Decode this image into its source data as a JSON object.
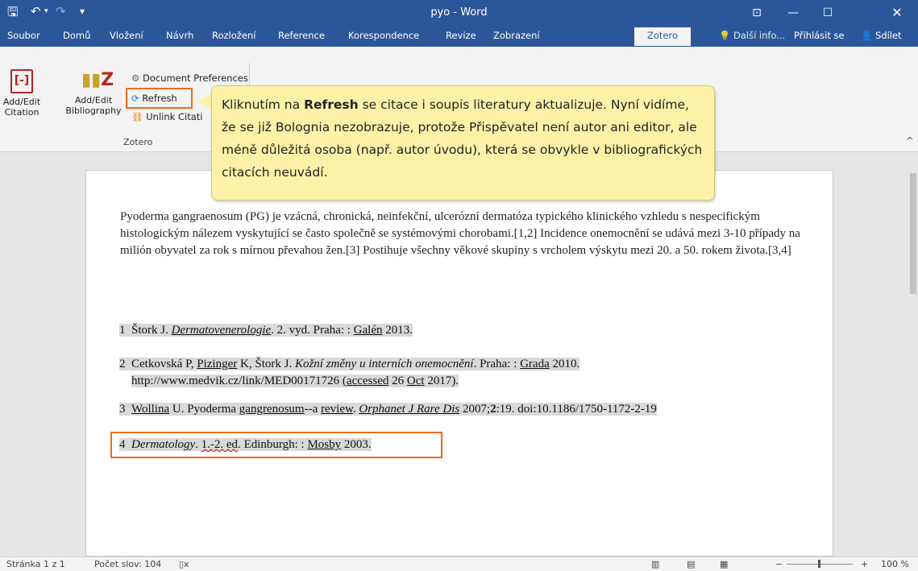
{
  "window": {
    "title": "pyo - Word",
    "undo_icon": "undo-icon",
    "redo_icon": "redo-icon"
  },
  "tabs": [
    "Soubor",
    "Domů",
    "Vložení",
    "Návrh",
    "Rozložení",
    "Reference",
    "Korespondence",
    "Revize",
    "Zobrazení",
    "Zotero"
  ],
  "active_tab": "Zotero",
  "tellme": "Další info...",
  "signin": "Přihlásit se",
  "share": "Sdílet",
  "ribbon": {
    "add_edit_citation_1": "Add/Edit",
    "add_edit_citation_2": "Citation",
    "add_edit_bibliography_1": "Add/Edit",
    "add_edit_bibliography_2": "Bibliography",
    "document_preferences": "Document Preferences",
    "refresh": "Refresh",
    "unlink_citations": "Unlink Citati",
    "group_label": "Zotero"
  },
  "callout": {
    "pre": "Kliknutím na ",
    "bold": "Refresh",
    "post": " se citace i soupis literatury aktualizuje. Nyní vidíme, že se již Bolognia nezobrazuje, protože Přispěvatel není autor ani editor, ale méně důležitá osoba (např. autor úvodu), která se obvykle v bibliografických citacích neuvádí."
  },
  "document": {
    "paragraph": "Pyoderma gangraenosum (PG) je vzácná, chronická, neinfekční, ulcerózní dermatóza typického klinického vzhledu s nespecifickým histologickým nálezem vyskytující se často společně se systémovými chorobami.[1,2] Incidence onemocnění se udává mezi 3-10 případy na milión obyvatel za rok s mírnou převahou žen.[3] Postihuje všechny věkové skupiny s vrcholem výskytu mezi 20. a 50. rokem života.[3,4]",
    "refs": {
      "r1_num": "1",
      "r1_a": "Štork J. ",
      "r1_i": "Dermatovenerologie",
      "r1_b": ". 2. vyd. Praha: : ",
      "r1_c": "Galén",
      "r1_d": " 2013.",
      "r2_num": "2",
      "r2_a": "Cetkovská P, ",
      "r2_b": "Pizinger",
      "r2_c": " K, Štork J. ",
      "r2_i": "Kožní změny u interních onemocnění",
      "r2_d": ". Praha: : ",
      "r2_e": "Grada",
      "r2_f": " 2010.",
      "r2_line2a": "http://www.medvik.cz/link/MED00171726 (",
      "r2_line2b": "accessed",
      "r2_line2c": " 26 ",
      "r2_line2d": "Oct",
      "r2_line2e": " 2017).",
      "r3_num": "3",
      "r3_a": "Wollina",
      "r3_b": " U. Pyoderma ",
      "r3_c": "gangrenosum",
      "r3_d": "--a ",
      "r3_e": "review",
      "r3_f": ". ",
      "r3_i": "Orphanet J Rare Dis",
      "r3_g": " 2007;",
      "r3_bold": "2",
      "r3_h": ":19. doi:10.1186/1750-1172-2-19",
      "r4_num": "4",
      "r4_i": "Dermatology",
      "r4_a": ". ",
      "r4_b": "1.-2. ed",
      "r4_c": ". Edinburgh: : ",
      "r4_d": "Mosby",
      "r4_e": " 2003."
    }
  },
  "status": {
    "page": "Stránka 1 z 1",
    "words": "Počet slov: 104",
    "zoom": "100 %"
  }
}
